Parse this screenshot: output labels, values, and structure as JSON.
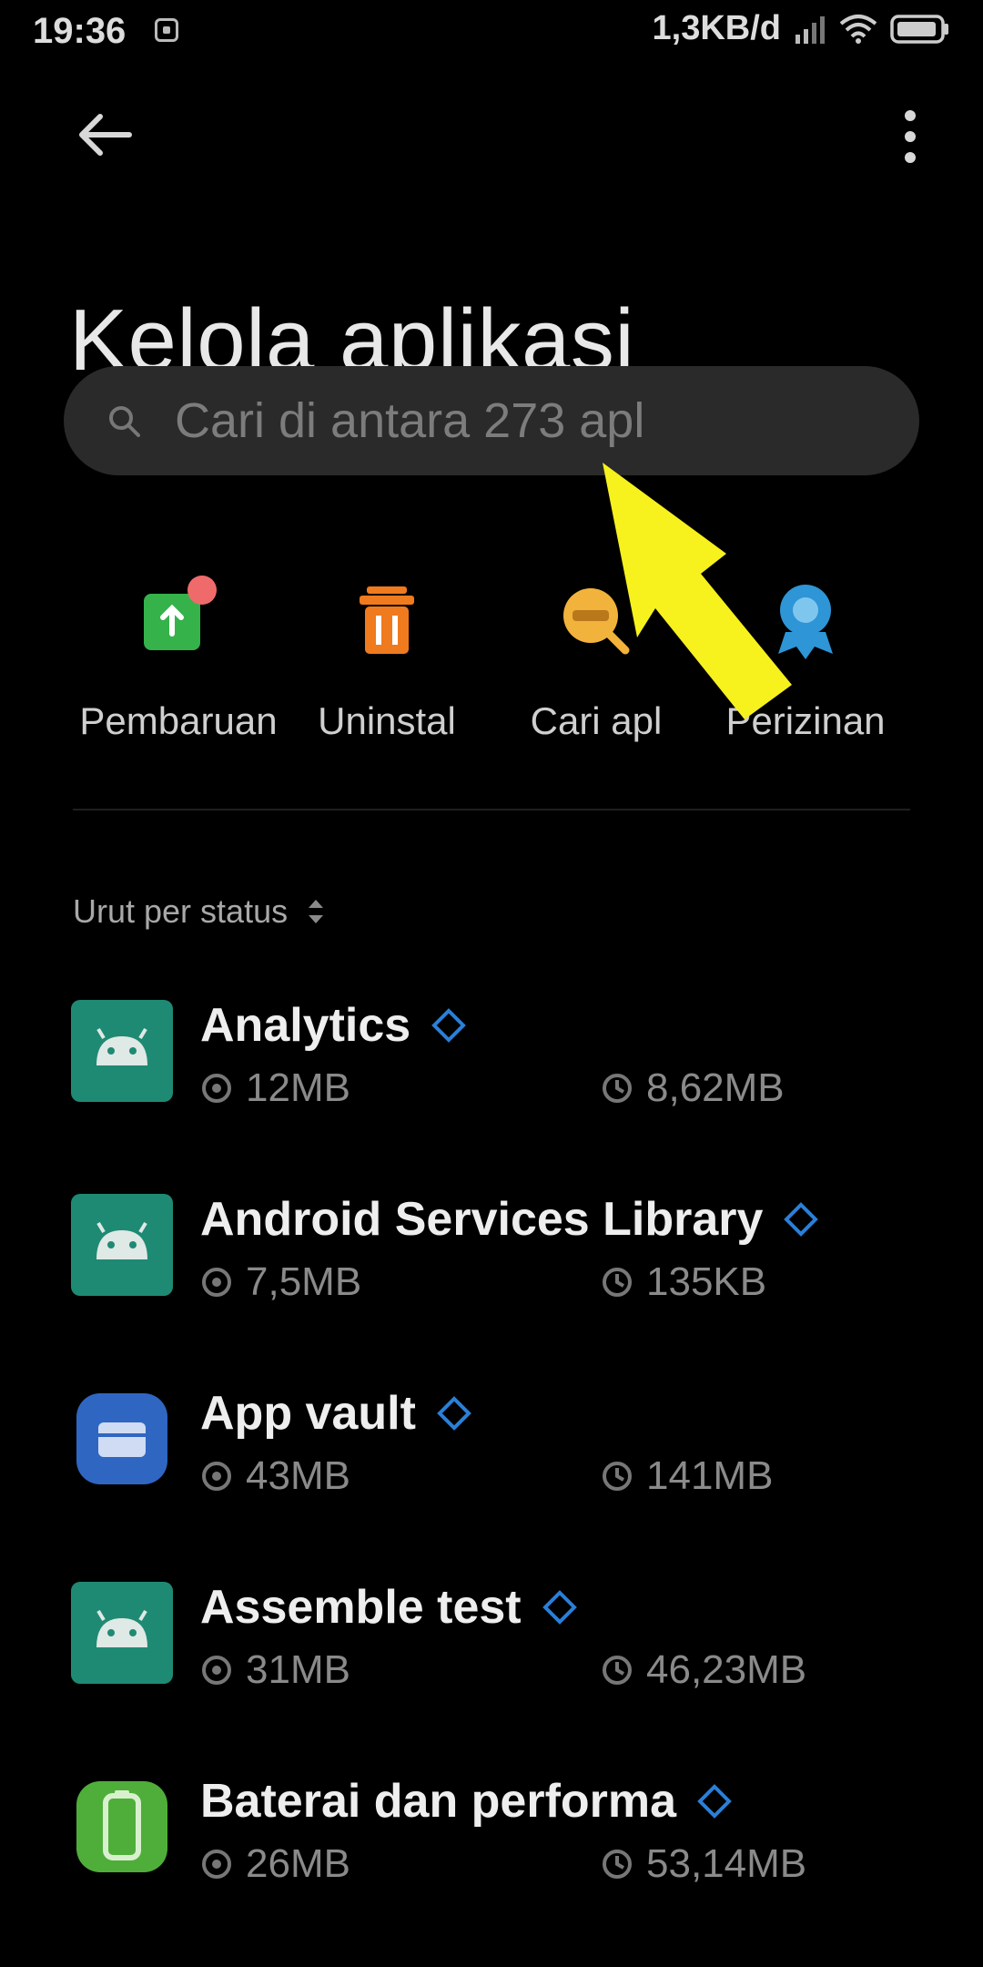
{
  "status": {
    "time": "19:36",
    "speed": "1,3KB/d"
  },
  "page": {
    "title": "Kelola aplikasi"
  },
  "search": {
    "placeholder": "Cari di antara 273 apl"
  },
  "actions": [
    {
      "label": "Pembaruan",
      "icon": "update-icon",
      "color": "#35b24a"
    },
    {
      "label": "Uninstal",
      "icon": "trash-icon",
      "color": "#f07a1e"
    },
    {
      "label": "Cari apl",
      "icon": "search-apk-icon",
      "color": "#f2b33c"
    },
    {
      "label": "Perizinan",
      "icon": "permission-icon",
      "color": "#2e95d6"
    }
  ],
  "sort": {
    "label": "Urut per status"
  },
  "apps": [
    {
      "name": "Analytics",
      "size": "12MB",
      "cache": "8,62MB",
      "icon": "android-icon",
      "color": "#1f8a73"
    },
    {
      "name": "Android Services Library",
      "size": "7,5MB",
      "cache": "135KB",
      "icon": "android-icon",
      "color": "#1f8a73"
    },
    {
      "name": "App vault",
      "size": "43MB",
      "cache": "141MB",
      "icon": "app-vault-icon",
      "color": "#2f66c2"
    },
    {
      "name": "Assemble test",
      "size": "31MB",
      "cache": "46,23MB",
      "icon": "android-icon",
      "color": "#1f8a73"
    },
    {
      "name": "Baterai dan performa",
      "size": "26MB",
      "cache": "53,14MB",
      "icon": "battery-icon",
      "color": "#4fae3a"
    }
  ],
  "colors": {
    "background": "#000000",
    "search_bg": "#2a2a2a",
    "badge": "#2a7fd8",
    "arrow": "#f7f11e"
  }
}
